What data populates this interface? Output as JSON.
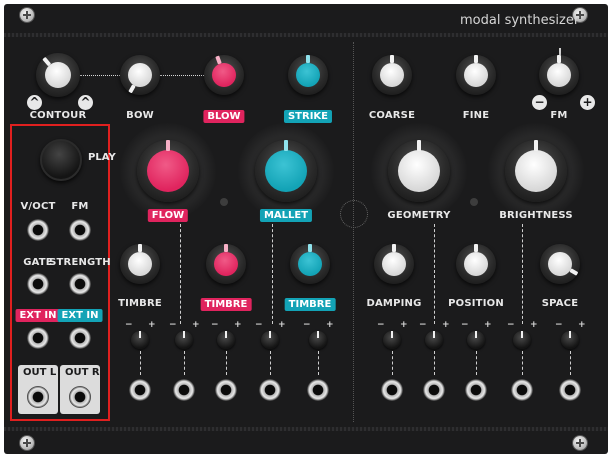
{
  "module": {
    "title": "modal synthesizer",
    "colors": {
      "panel": "#1b1b1c",
      "accent_red": "#e0245e",
      "accent_teal": "#13a3b6",
      "highlight_box": "#e0201f"
    }
  },
  "top_row": {
    "contour": "CONTOUR",
    "bow": "BOW",
    "blow": "BLOW",
    "strike": "STRIKE",
    "coarse": "COARSE",
    "fine": "FINE",
    "fm": "FM",
    "fm_minus": "−",
    "fm_plus": "+"
  },
  "left_column": {
    "play": "PLAY",
    "voct": "V/OCT",
    "fm": "FM",
    "gate": "GATE",
    "strength": "STRENGTH",
    "ext_in_red": "EXT IN",
    "ext_in_teal": "EXT IN",
    "out_l": "OUT L",
    "out_r": "OUT R"
  },
  "middle": {
    "flow": "FLOW",
    "mallet": "MALLET",
    "geometry": "GEOMETRY",
    "brightness": "BRIGHTNESS",
    "timbre_white": "TIMBRE",
    "timbre_red": "TIMBRE",
    "timbre_teal": "TIMBRE",
    "damping": "DAMPING",
    "position": "POSITION",
    "space": "SPACE"
  },
  "attenuverter_signs": {
    "minus": "−",
    "plus": "+"
  }
}
